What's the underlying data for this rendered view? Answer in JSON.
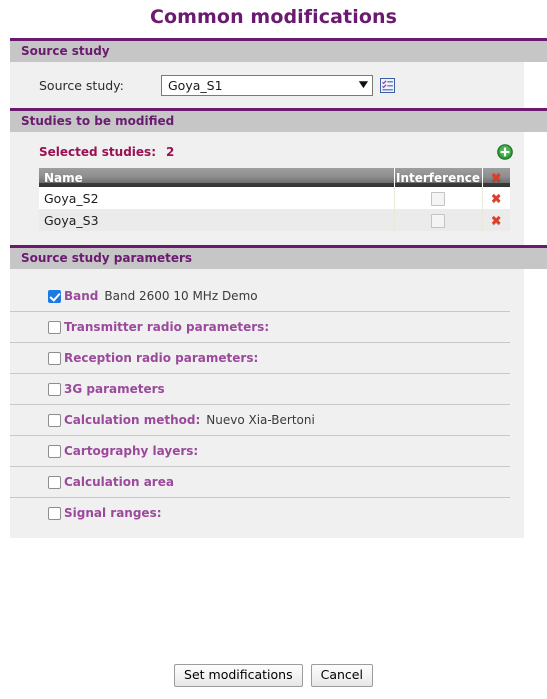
{
  "page": {
    "title": "Common modifications",
    "title_color": "#6a1b70"
  },
  "sections": {
    "source_study": {
      "header": "Source study",
      "field_label": "Source study:",
      "selected_value": "Goya_S1",
      "options": [
        "Goya_S1"
      ],
      "picker_icon": "checklist-icon",
      "dropdown_icon": "chevron-down-icon"
    },
    "studies": {
      "header": "Studies to be modified",
      "selected_label": "Selected studies:",
      "selected_count": "2",
      "add_icon": "add-circle-icon",
      "columns": [
        "Name",
        "Interference",
        ""
      ],
      "delete_all_icon": "delete-red-x-icon",
      "rows": [
        {
          "name": "Goya_S2",
          "interference_checked": false,
          "delete_icon": "delete-red-x-icon"
        },
        {
          "name": "Goya_S3",
          "interference_checked": false,
          "delete_icon": "delete-red-x-icon"
        }
      ]
    },
    "parameters": {
      "header": "Source study parameters",
      "items": [
        {
          "label": "Band",
          "value": "Band 2600 10 MHz Demo",
          "checked": true
        },
        {
          "label": "Transmitter radio parameters:",
          "value": "",
          "checked": false
        },
        {
          "label": "Reception radio parameters:",
          "value": "",
          "checked": false
        },
        {
          "label": "3G parameters",
          "value": "",
          "checked": false
        },
        {
          "label": "Calculation method:",
          "value": "Nuevo Xia-Bertoni",
          "checked": false
        },
        {
          "label": "Cartography layers:",
          "value": "",
          "checked": false
        },
        {
          "label": "Calculation area",
          "value": "",
          "checked": false
        },
        {
          "label": "Signal ranges:",
          "value": "",
          "checked": false
        }
      ]
    }
  },
  "footer": {
    "submit_label": "Set modifications",
    "cancel_label": "Cancel"
  },
  "colors": {
    "accent_purple": "#6a1b70",
    "label_purple": "#9b4a9b",
    "crimson": "#9b1050",
    "header_grey": "#c6c6c6",
    "body_grey": "#f0f0f0",
    "checkbox_blue": "#1a7ae8",
    "delete_red": "#e23b26",
    "add_green": "#2e9e35"
  }
}
